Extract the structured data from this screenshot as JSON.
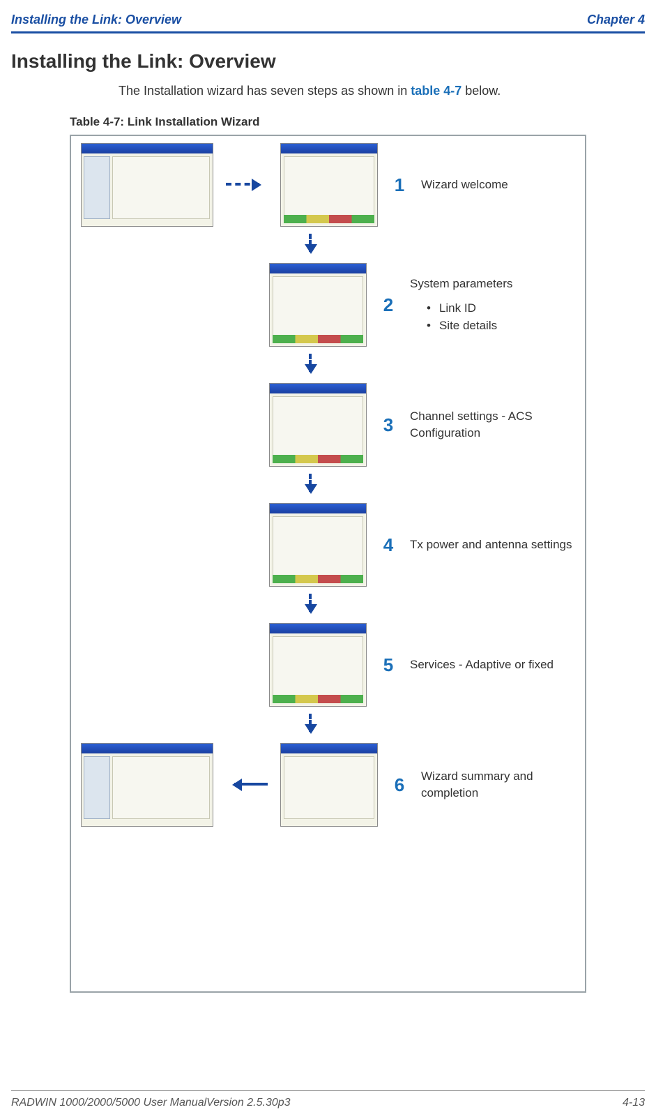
{
  "header": {
    "left": "Installing the Link: Overview",
    "right": "Chapter 4"
  },
  "section_title": "Installing the Link: Overview",
  "intro": {
    "prefix": "The Installation wizard has seven steps as shown in ",
    "link_text": "table 4-7",
    "suffix": " below."
  },
  "table_caption": "Table 4-7: Link Installation Wizard",
  "steps": [
    {
      "num": "1",
      "desc": "Wizard welcome"
    },
    {
      "num": "2",
      "desc": "System parameters",
      "bullets": [
        "Link ID",
        "Site details"
      ]
    },
    {
      "num": "3",
      "desc": "Channel settings - ACS Configuration"
    },
    {
      "num": "4",
      "desc": "Tx power and antenna settings"
    },
    {
      "num": "5",
      "desc": "Services - Adaptive or fixed"
    },
    {
      "num": "6",
      "desc": "Wizard summary and completion"
    }
  ],
  "footer": {
    "left": "RADWIN 1000/2000/5000 User ManualVersion  2.5.30p3",
    "right": "4-13"
  }
}
